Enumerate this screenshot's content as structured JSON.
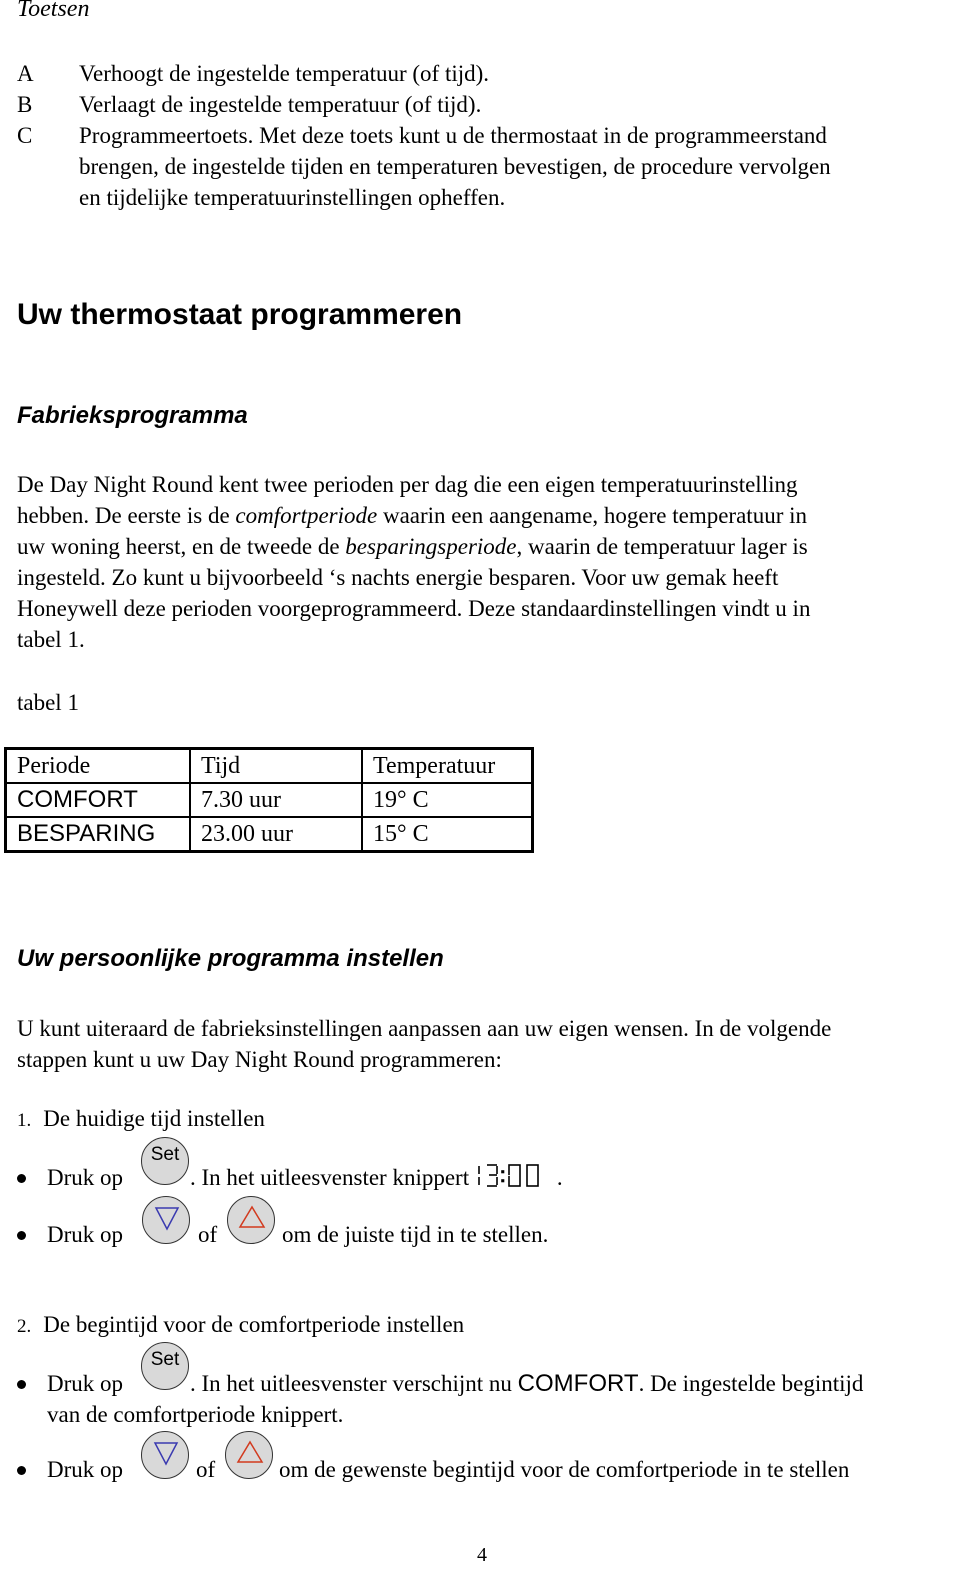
{
  "section_title": "Toetsen",
  "keys": [
    {
      "letter": "A",
      "text": "Verhoogt de ingestelde temperatuur (of tijd)."
    },
    {
      "letter": "B",
      "text": "Verlaagt de ingestelde temperatuur (of tijd)."
    },
    {
      "letter": "C",
      "lines": [
        "Programmeertoets. Met deze toets kunt u de thermostaat in de  programmeerstand",
        "brengen, de ingestelde tijden en temperaturen bevestigen, de procedure vervolgen",
        "en tijdelijke temperatuurinstellingen opheffen."
      ]
    }
  ],
  "heading_main": "Uw thermostaat programmeren",
  "heading_factory": "Fabrieksprogramma",
  "factory_para": {
    "l1": "De Day Night Round kent twee perioden per dag die een eigen temperatuurinstelling",
    "l2a": "hebben. De eerste is de ",
    "l2_em": "comfortperiode",
    "l2b": " waarin een aangename, hogere temperatuur in",
    "l3a": "uw woning heerst, en de tweede de ",
    "l3_em": "besparingsperiode",
    "l3b": ", waarin de temperatuur lager is",
    "l4": "ingesteld. Zo kunt u bijvoorbeeld ‘s nachts energie besparen. Voor uw gemak heeft",
    "l5": "Honeywell deze perioden voorgeprogrammeerd. Deze standaardinstellingen vindt u in",
    "l6": "tabel 1."
  },
  "table_caption": "tabel 1",
  "table": {
    "headers": [
      "Periode",
      "Tijd",
      "Temperatuur"
    ],
    "rows": [
      [
        "COMFORT",
        "7.30 uur",
        "19° C"
      ],
      [
        "BESPARING",
        "23.00 uur",
        "15° C"
      ]
    ]
  },
  "heading_personal": "Uw persoonlijke programma instellen",
  "personal_para": {
    "l1": "U kunt uiteraard de fabrieksinstellingen aanpassen aan uw eigen wensen. In de volgende",
    "l2": "stappen kunt u uw Day Night Round programmeren:"
  },
  "steps": [
    {
      "num": "1.",
      "title": "De huidige tijd instellen",
      "b1_pre": "Druk op",
      "b1_post": ". In het uitleesvenster knippert",
      "b1_display": "13:00",
      "b1_end": ".",
      "b2_pre": "Druk op",
      "b2_mid": "of",
      "b2_post": "om de juiste tijd in te stellen."
    },
    {
      "num": "2.",
      "title": "De begintijd voor de comfortperiode instellen",
      "b1_pre": "Druk op",
      "b1_post": ". In het uitleesvenster verschijnt nu ",
      "b1_display": "COMFORT",
      "b1_end": ". De ingestelde begintijd",
      "b1_line2": "van de comfortperiode knippert.",
      "b2_pre": "Druk op",
      "b2_mid": "of",
      "b2_post": "om de gewenste begintijd voor de comfortperiode in te stellen"
    }
  ],
  "buttons": {
    "set_label": "Set",
    "down_color": "#3a3ab0",
    "up_color": "#d23a1e"
  },
  "page_number": "4"
}
